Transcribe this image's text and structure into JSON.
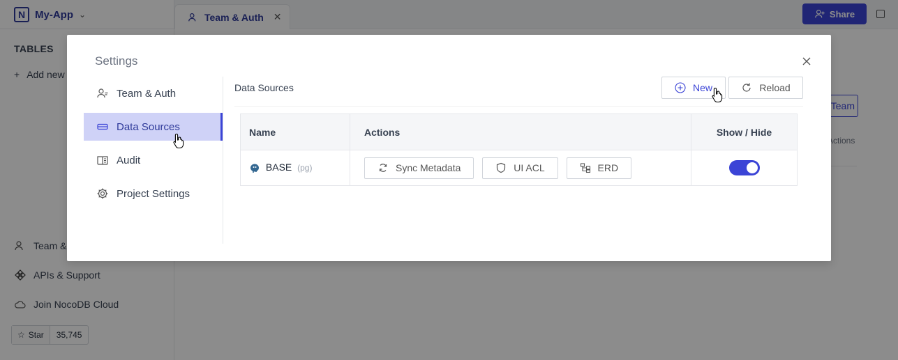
{
  "app": {
    "name": "My-App",
    "tab_label": "Team & Auth",
    "share_label": "Share",
    "sidebar_title": "TABLES",
    "add_new_label": "Add new table",
    "sidebar_bottom": {
      "team": "Team & Auth",
      "apis": "APIs & Support",
      "cloud": "Join NocoDB Cloud",
      "star_label": "Star",
      "star_count": "35,745"
    },
    "bg_team_button": "Team",
    "bg_actions_label": "Actions"
  },
  "modal": {
    "title": "Settings",
    "menu": [
      {
        "label": "Team & Auth",
        "icon": "users-icon"
      },
      {
        "label": "Data Sources",
        "icon": "database-icon"
      },
      {
        "label": "Audit",
        "icon": "book-icon"
      },
      {
        "label": "Project Settings",
        "icon": "gear-icon"
      }
    ],
    "active_menu": "Data Sources",
    "content": {
      "title": "Data Sources",
      "new_label": "New",
      "reload_label": "Reload",
      "columns": [
        "Name",
        "Actions",
        "Show / Hide"
      ],
      "rows": [
        {
          "name": "BASE",
          "type": "(pg)",
          "actions": [
            "Sync Metadata",
            "UI ACL",
            "ERD"
          ],
          "visible": true
        }
      ]
    }
  },
  "colors": {
    "accent": "#3b44d6",
    "active_bg": "#cfd2f7"
  }
}
